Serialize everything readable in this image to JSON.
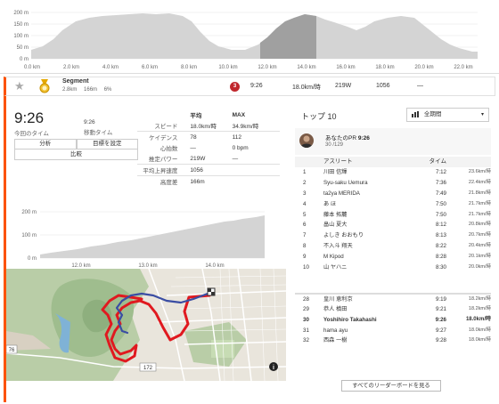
{
  "overview_chart": {
    "y_ticks": [
      "200 m",
      "150 m",
      "100 m",
      "50 m",
      "0 m"
    ],
    "x_ticks": [
      "0.0 km",
      "2.0 km",
      "4.0 km",
      "6.0 km",
      "8.0 km",
      "10.0 km",
      "12.0 km",
      "14.0 km",
      "16.0 km",
      "18.0 km",
      "20.0 km",
      "22.0 km"
    ]
  },
  "segment_row": {
    "name": "Segment",
    "distance": "2.8km",
    "elevation": "166m",
    "grade": "6%",
    "warning_badge": "3",
    "time": "9:26",
    "speed": "18.0km/時",
    "power": "219W",
    "extra": "1056",
    "dash": "—"
  },
  "effort": {
    "elapsed_time": "9:26",
    "elapsed_label": "今回のタイム",
    "moving_time": "9:26",
    "moving_label": "移動タイム",
    "btn_analysis": "分析",
    "btn_goal": "目標を設定",
    "btn_compare": "比較"
  },
  "stats": {
    "header_avg": "平均",
    "header_max": "MAX",
    "rows": [
      {
        "label": "スピード",
        "avg": "18.0km/時",
        "max": "34.9km/時"
      },
      {
        "label": "ケイデンス",
        "avg": "78",
        "max": "112"
      },
      {
        "label": "心拍数",
        "avg": "—",
        "max": "0 bpm"
      },
      {
        "label": "推定パワー",
        "avg": "219W",
        "max": "—"
      }
    ],
    "vam_label": "平均上昇速度",
    "vam_value": "1056",
    "elev_label": "高度差",
    "elev_value": "166m"
  },
  "segment_elev": {
    "y_ticks": [
      "200 m",
      "100 m",
      "0 m"
    ],
    "x_ticks": [
      "12.0 km",
      "13.0 km",
      "14.0 km"
    ]
  },
  "map": {
    "road_label": "172",
    "road_label2": "76",
    "info_icon": "i"
  },
  "top10": {
    "title": "トップ 10",
    "period": "全期間",
    "pr_name": "あなたのPR",
    "pr_time": "9:26",
    "pr_rank": "30 /129",
    "col_athlete": "アスリート",
    "col_time": "タイム",
    "rows": [
      {
        "rank": "1",
        "name": "川田 信輝",
        "time": "7:12",
        "speed": "23.6km/時"
      },
      {
        "rank": "2",
        "name": "Syu-saku Uemura",
        "time": "7:36",
        "speed": "22.4km/時"
      },
      {
        "rank": "3",
        "name": "ta2ya MERIDA",
        "time": "7:49",
        "speed": "21.8km/時"
      },
      {
        "rank": "4",
        "name": "あ ほ",
        "time": "7:50",
        "speed": "21.7km/時"
      },
      {
        "rank": "5",
        "name": "藤本 拓麓",
        "time": "7:50",
        "speed": "21.7km/時"
      },
      {
        "rank": "6",
        "name": "畠山 夏大",
        "time": "8:12",
        "speed": "20.8km/時"
      },
      {
        "rank": "7",
        "name": "よしき おおもり",
        "time": "8:13",
        "speed": "20.7km/時"
      },
      {
        "rank": "8",
        "name": "不入斗 翔天",
        "time": "8:22",
        "speed": "20.4km/時"
      },
      {
        "rank": "9",
        "name": "M Kipod",
        "time": "8:28",
        "speed": "20.1km/時"
      },
      {
        "rank": "10",
        "name": "山 ヤハニ",
        "time": "8:30",
        "speed": "20.0km/時"
      }
    ],
    "rows_near": [
      {
        "rank": "28",
        "name": "皇川 恵利京",
        "time": "9:19",
        "speed": "18.2km/時",
        "me": false
      },
      {
        "rank": "29",
        "name": "恭人 槙田",
        "time": "9:21",
        "speed": "18.2km/時",
        "me": false
      },
      {
        "rank": "30",
        "name": "Yoshihiro Takahashi",
        "time": "9:26",
        "speed": "18.0km/時",
        "me": true
      },
      {
        "rank": "31",
        "name": "hama ayu",
        "time": "9:27",
        "speed": "18.0km/時",
        "me": false
      },
      {
        "rank": "32",
        "name": "西森 一樹",
        "time": "9:28",
        "speed": "18.0km/時",
        "me": false
      }
    ],
    "all_leaderboards": "すべてのリーダーボードを見る"
  },
  "colors": {
    "accent": "#fc5200",
    "route_red": "#e0191f",
    "route_blue": "#3a4da3",
    "elev_fill": "#cfcfcf",
    "elev_highlight": "#9a9a9a"
  }
}
